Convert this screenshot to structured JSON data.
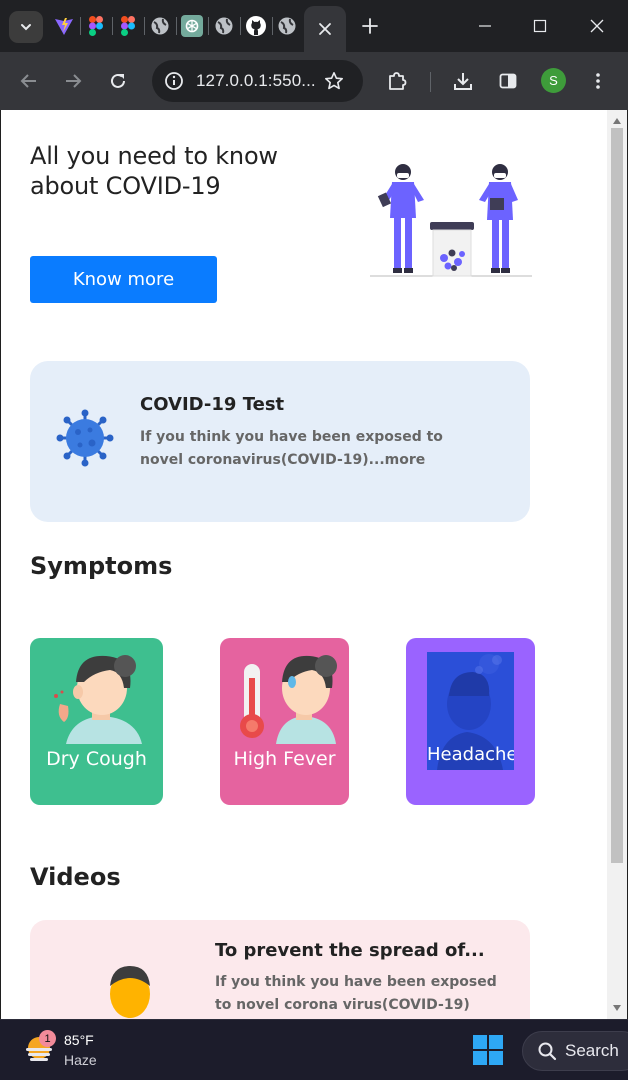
{
  "browser": {
    "url": "127.0.0.1:550...",
    "profile_initial": "S"
  },
  "hero": {
    "title": "All you need to know about COVID-19",
    "button_label": "Know more"
  },
  "test_card": {
    "title": "COVID-19 Test",
    "description": "If you think you have been exposed to novel coronavirus(COVID-19)...more"
  },
  "symptoms": {
    "heading": "Symptoms",
    "items": [
      {
        "label": "Dry Cough",
        "color": "#3ebf8f"
      },
      {
        "label": "High Fever",
        "color": "#e5639f"
      },
      {
        "label": "Headache",
        "color": "#9a63ff"
      }
    ]
  },
  "videos": {
    "heading": "Videos",
    "items": [
      {
        "title": "To prevent the spread of...",
        "description": "If you think you have been exposed to novel corona virus(COVID-19)"
      }
    ]
  },
  "taskbar": {
    "weather_badge": "1",
    "temperature": "85°F",
    "condition": "Haze",
    "search_label": "Search"
  },
  "colors": {
    "primary_button": "#0a7cff",
    "test_card_bg": "#e5eef9",
    "video_card_bg": "#fce9ec",
    "illustration_accent": "#6c63ff"
  }
}
